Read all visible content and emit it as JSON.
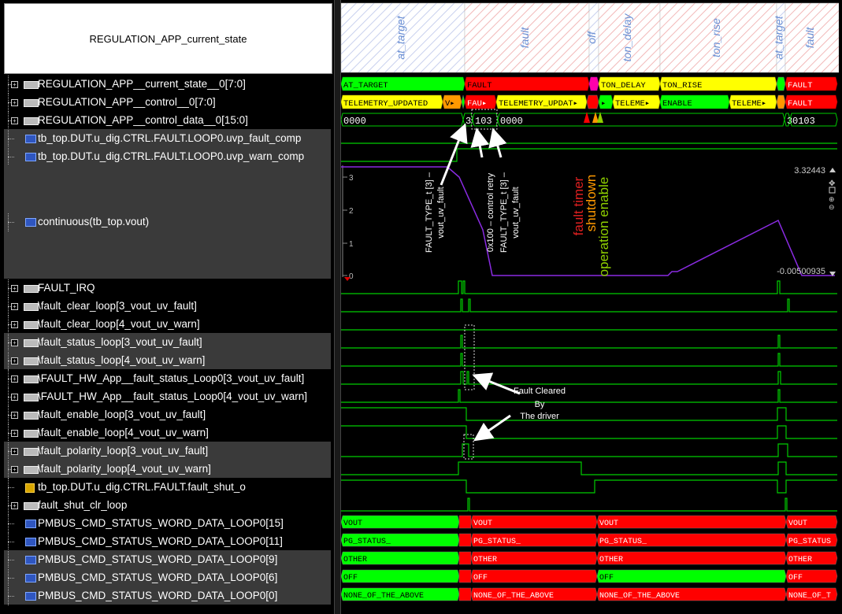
{
  "header": {
    "title": "REGULATION_APP_current_state"
  },
  "signals": [
    {
      "name": "REGULATION_APP__current_state__0[7:0]",
      "icon": "bus-icon",
      "expand": true
    },
    {
      "name": "REGULATION_APP__control__0[7:0]",
      "icon": "bus-icon",
      "expand": true
    },
    {
      "name": "REGULATION_APP__control_data__0[15:0]",
      "icon": "bus-icon",
      "expand": true
    },
    {
      "name": "tb_top.DUT.u_dig.CTRL.FAULT.LOOP0.uvp_fault_comp",
      "icon": "wire-icon",
      "expand": false
    },
    {
      "name": "tb_top.DUT.u_dig.CTRL.FAULT.LOOP0.uvp_warn_comp",
      "icon": "wire-icon",
      "expand": false
    },
    {
      "name": "continuous(tb_top.vout)",
      "icon": "wire-icon",
      "expand": false
    },
    {
      "name": "FAULT_IRQ",
      "icon": "bus-icon",
      "expand": true
    },
    {
      "name": "\\fault_clear_loop[3_vout_uv_fault]",
      "icon": "bus-icon",
      "expand": true
    },
    {
      "name": "\\fault_clear_loop[4_vout_uv_warn]",
      "icon": "bus-icon",
      "expand": true
    },
    {
      "name": "\\fault_status_loop[3_vout_uv_fault]",
      "icon": "bus-icon",
      "expand": true
    },
    {
      "name": "\\fault_status_loop[4_vout_uv_warn]",
      "icon": "bus-icon",
      "expand": true
    },
    {
      "name": "\\FAULT_HW_App__fault_status_Loop0[3_vout_uv_fault]",
      "icon": "bus-icon",
      "expand": true
    },
    {
      "name": "\\FAULT_HW_App__fault_status_Loop0[4_vout_uv_warn]",
      "icon": "bus-icon",
      "expand": true
    },
    {
      "name": "\\fault_enable_loop[3_vout_uv_fault]",
      "icon": "bus-icon",
      "expand": true
    },
    {
      "name": "\\fault_enable_loop[4_vout_uv_warn]",
      "icon": "bus-icon",
      "expand": true
    },
    {
      "name": "\\fault_polarity_loop[3_vout_uv_fault]",
      "icon": "bus-icon",
      "expand": true
    },
    {
      "name": "\\fault_polarity_loop[4_vout_uv_warn]",
      "icon": "bus-icon",
      "expand": true
    },
    {
      "name": "tb_top.DUT.u_dig.CTRL.FAULT.fault_shut_o",
      "icon": "output-icon",
      "expand": false
    },
    {
      "name": "fault_shut_clr_loop",
      "icon": "bus-icon",
      "expand": true
    },
    {
      "name": "PMBUS_CMD_STATUS_WORD_DATA_LOOP0[15]",
      "icon": "wire-icon",
      "expand": false
    },
    {
      "name": "PMBUS_CMD_STATUS_WORD_DATA_LOOP0[11]",
      "icon": "wire-icon",
      "expand": false
    },
    {
      "name": "PMBUS_CMD_STATUS_WORD_DATA_LOOP0[9]",
      "icon": "wire-icon",
      "expand": false
    },
    {
      "name": "PMBUS_CMD_STATUS_WORD_DATA_LOOP0[6]",
      "icon": "wire-icon",
      "expand": false
    },
    {
      "name": "PMBUS_CMD_STATUS_WORD_DATA_LOOP0[0]",
      "icon": "wire-icon",
      "expand": false
    }
  ],
  "state_header": {
    "labels": [
      "at_target",
      "fault",
      "off",
      "ton_delay",
      "ton_rise",
      "at_target",
      "fault"
    ]
  },
  "buses": {
    "current_state": [
      "AT_TARGET",
      "FAULT",
      "TON_DELAY",
      "TON_RISE",
      "FAULT"
    ],
    "control": [
      "TELEMETRY_UPDATED",
      "V▸",
      "FAU▸",
      "TELEMETRY_UPDAT▸",
      "▸",
      "TELEME▸",
      "ENABLE",
      "TELEME▸",
      "FAULT"
    ],
    "control_data": [
      "0000",
      "3",
      "103",
      "0000",
      "3",
      "0103"
    ]
  },
  "analog": {
    "y_max_label": "3.32443",
    "y_min_label": "-0.00500935",
    "ticks": [
      "3",
      "2",
      "1",
      "0"
    ]
  },
  "status_rows": [
    [
      "VOUT",
      "VOUT",
      "VOUT",
      "VOUT"
    ],
    [
      "PG_STATUS_",
      "PG_STATUS_",
      "PG_STATUS_",
      "PG_STATUS"
    ],
    [
      "OTHER",
      "OTHER",
      "OTHER",
      "OTHER"
    ],
    [
      "OFF",
      "OFF",
      "OFF",
      "OFF"
    ],
    [
      "NONE_OF_THE_ABOVE",
      "NONE_OF_THE_ABOVE",
      "NONE_OF_THE_ABOVE",
      "NONE_OF_T"
    ]
  ],
  "annotations": {
    "fault_type_1": "FAULT_TYPE_t [3] –",
    "fault_type_1b": "vout_uv_fault",
    "control_retry": "0x100 – control retry",
    "fault_type_2": "FAULT_TYPE_t [3] –",
    "fault_type_2b": "vout_uv_fault",
    "fault_timer": "fault timer",
    "shutdown": "shutdown",
    "operation_enable": "operation enable",
    "fault_cleared_1": "Fault Cleared",
    "fault_cleared_2": "By",
    "fault_cleared_3": "The driver"
  },
  "colors": {
    "green": "#00ff00",
    "red": "#ff0000",
    "yellow": "#ffff00",
    "orange": "#ff9900",
    "trace": "#00cc00",
    "analog": "#8a2be2"
  }
}
